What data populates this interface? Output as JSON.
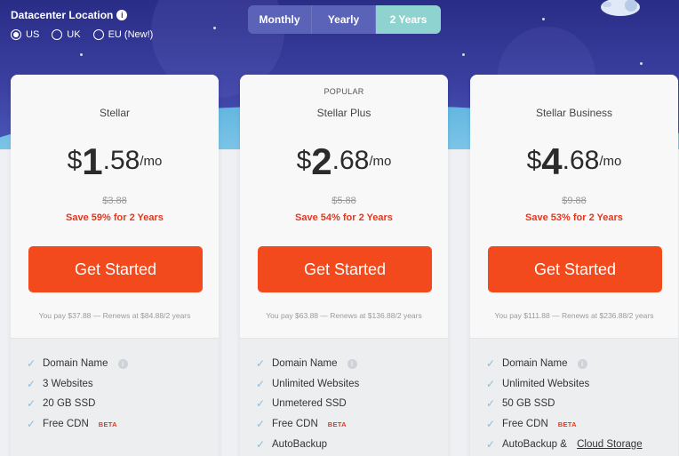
{
  "datacenter": {
    "title": "Datacenter Location",
    "options": [
      {
        "label": "US",
        "selected": true
      },
      {
        "label": "UK",
        "selected": false
      },
      {
        "label": "EU (New!)",
        "selected": false
      }
    ]
  },
  "billing_toggle": [
    "Monthly",
    "Yearly",
    "2 Years"
  ],
  "selected_billing": "2 Years",
  "colors": {
    "accent": "#f34a1d",
    "save_red": "#e8361a",
    "toggle_active": "#8fd3d0",
    "hero": "#2a2d86"
  },
  "plans": [
    {
      "tag": "",
      "name": "Stellar",
      "currency": "$",
      "dollars": "1",
      "cents": ".58",
      "per": "/mo",
      "old_price": "$3.88",
      "save": "Save 59% for 2 Years",
      "cta": "Get Started",
      "pay": "You pay $37.88 — Renews at $84.88/2 years",
      "features": [
        "Domain Name",
        "3 Websites",
        "20 GB SSD",
        "Free CDN"
      ]
    },
    {
      "tag": "POPULAR",
      "name": "Stellar Plus",
      "currency": "$",
      "dollars": "2",
      "cents": ".68",
      "per": "/mo",
      "old_price": "$5.88",
      "save": "Save 54% for 2 Years",
      "cta": "Get Started",
      "pay": "You pay $63.88 — Renews at $136.88/2 years",
      "features": [
        "Domain Name",
        "Unlimited Websites",
        "Unmetered SSD",
        "Free CDN",
        "AutoBackup"
      ]
    },
    {
      "tag": "",
      "name": "Stellar Business",
      "currency": "$",
      "dollars": "4",
      "cents": ".68",
      "per": "/mo",
      "old_price": "$9.88",
      "save": "Save 53% for 2 Years",
      "cta": "Get Started",
      "pay": "You pay $111.88 — Renews at $236.88/2 years",
      "features": [
        "Domain Name",
        "Unlimited Websites",
        "50 GB SSD",
        "Free CDN",
        "AutoBackup & ",
        "Cloud Storage"
      ]
    }
  ],
  "labels": {
    "beta": "BETA",
    "info": "i"
  }
}
